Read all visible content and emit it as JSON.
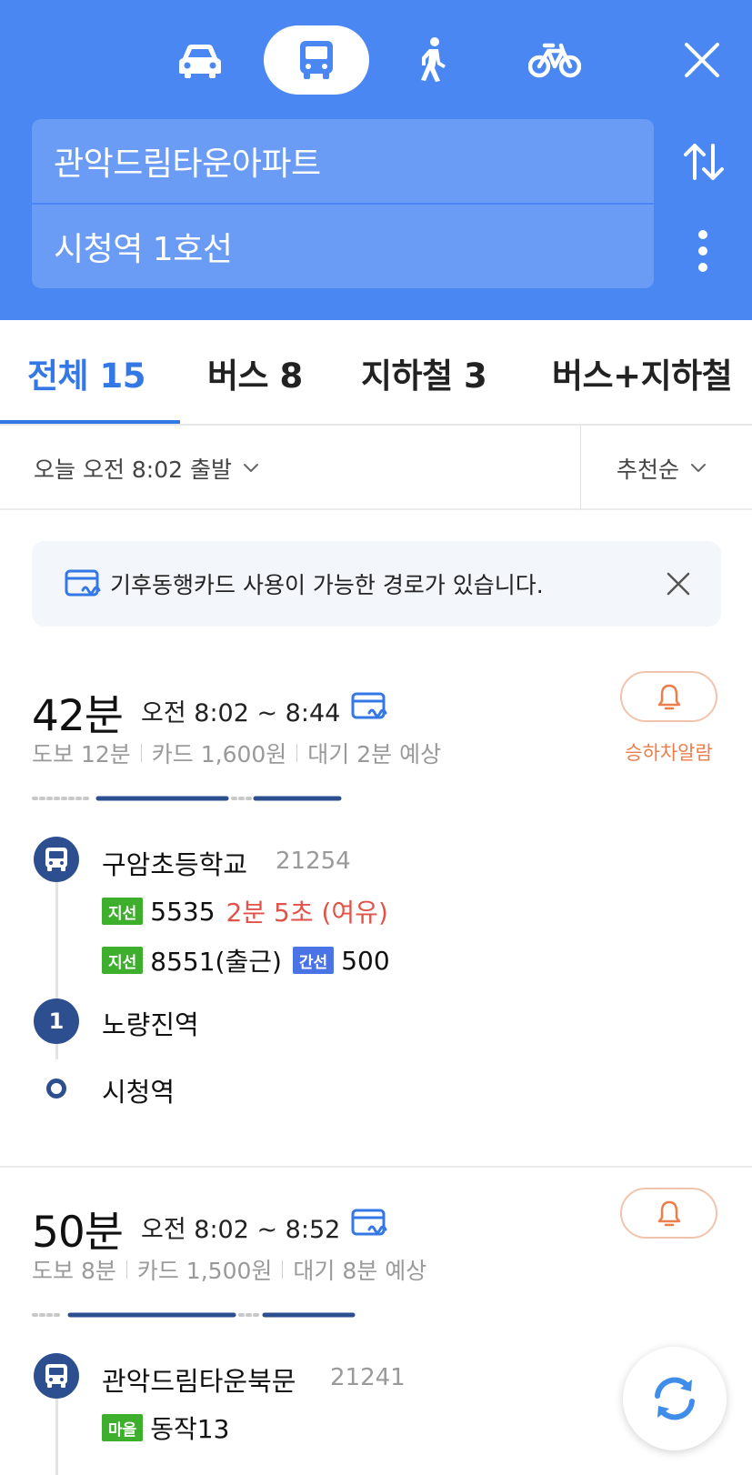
{
  "header": {
    "modes": [
      {
        "name": "car",
        "icon": "car-icon"
      },
      {
        "name": "transit",
        "icon": "bus-icon",
        "selected": true
      },
      {
        "name": "walk",
        "icon": "walk-icon"
      },
      {
        "name": "bike",
        "icon": "bike-icon"
      }
    ],
    "origin": "관악드림타운아파트",
    "destination": "시청역 1호선",
    "colors": {
      "background": "#4a87f3",
      "field": "#6b9cf5"
    }
  },
  "tabs": [
    {
      "label": "전체 15",
      "active": true
    },
    {
      "label": "버스 8"
    },
    {
      "label": "지하철 3"
    },
    {
      "label": "버스+지하철"
    }
  ],
  "filter": {
    "departure": "오늘 오전 8:02 출발",
    "sort": "추천순"
  },
  "notice": {
    "icon": "climate-card-icon",
    "text": "기후동행카드 사용이 가능한 경로가 있습니다."
  },
  "routes": [
    {
      "duration": "42분",
      "time_range": "오전 8:02 ~ 8:44",
      "meta": {
        "walk": "도보 12분",
        "fare": "카드 1,600원",
        "wait": "대기 2분 예상"
      },
      "alarm_label": "승하차알람",
      "stops": [
        {
          "name": "구암초등학교",
          "id": "21254",
          "icon": "bus-icon"
        },
        {
          "name": "노량진역",
          "line": "1"
        },
        {
          "name": "시청역"
        }
      ],
      "buses": [
        {
          "badge": "지선",
          "number": "5535",
          "wait": "2분 5초 (여유)"
        },
        {
          "badge": "지선",
          "number": "8551(출근)",
          "extra_badge": "간선",
          "extra_number": "500"
        }
      ]
    },
    {
      "duration": "50분",
      "time_range": "오전 8:02 ~ 8:52",
      "meta": {
        "walk": "도보 8분",
        "fare": "카드 1,500원",
        "wait": "대기 8분 예상"
      },
      "stops": [
        {
          "name": "관악드림타운북문",
          "id": "21241",
          "icon": "bus-icon"
        }
      ],
      "buses": [
        {
          "badge": "마을",
          "number": "동작13"
        }
      ]
    }
  ],
  "accent": "#3478e5"
}
